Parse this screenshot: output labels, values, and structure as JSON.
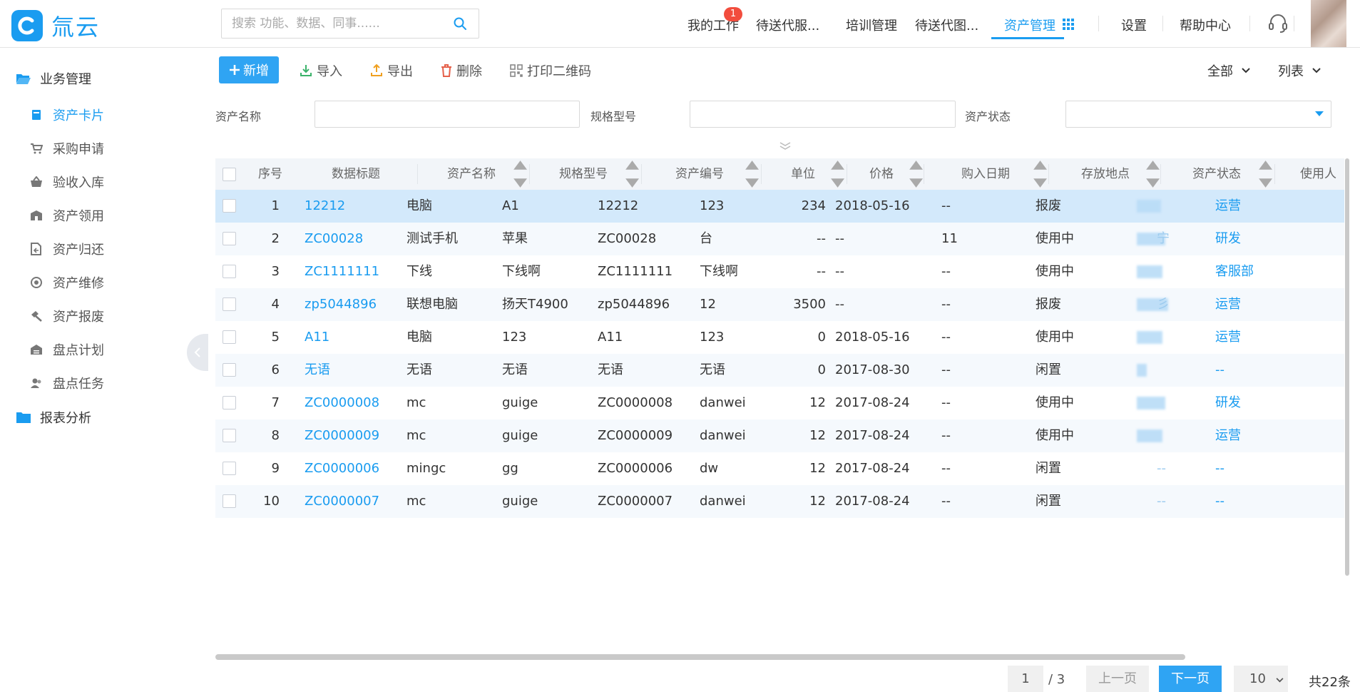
{
  "app": {
    "logo_text": "氚云"
  },
  "search": {
    "placeholder": "搜索 功能、数据、同事......"
  },
  "topnav": {
    "items": [
      "我的工作",
      "待送代服...",
      "培训管理",
      "待送代图...",
      "资产管理",
      "设置",
      "帮助中心"
    ],
    "badge": "1",
    "active": "资产管理"
  },
  "sidebar": {
    "group1": "业务管理",
    "items": [
      "资产卡片",
      "采购申请",
      "验收入库",
      "资产领用",
      "资产归还",
      "资产维修",
      "资产报废",
      "盘点计划",
      "盘点任务"
    ],
    "group2": "报表分析"
  },
  "toolbar": {
    "add": "新增",
    "import": "导入",
    "export": "导出",
    "delete": "删除",
    "print_qr": "打印二维码",
    "filter_all": "全部",
    "view_list": "列表"
  },
  "filters": {
    "asset_name": "资产名称",
    "spec_model": "规格型号",
    "asset_status": "资产状态"
  },
  "table": {
    "headers": [
      "序号",
      "数据标题",
      "资产名称",
      "规格型号",
      "资产编号",
      "单位",
      "价格",
      "购入日期",
      "存放地点",
      "资产状态",
      "使用人"
    ],
    "rows": [
      {
        "no": "1",
        "title": "12212",
        "name": "电脑",
        "spec": "A1",
        "code": "12212",
        "unit": "123",
        "price": "234",
        "date": "2018-05-16",
        "location": "--",
        "status": "报废",
        "user": "",
        "dept": "运营"
      },
      {
        "no": "2",
        "title": "ZC00028",
        "name": "测试手机",
        "spec": "苹果",
        "code": "ZC00028",
        "unit": "台",
        "price": "--",
        "date": "--",
        "location": "11",
        "status": "使用中",
        "user": "宁",
        "dept": "研发"
      },
      {
        "no": "3",
        "title": "ZC1111111",
        "name": "下线",
        "spec": "下线啊",
        "code": "ZC1111111",
        "unit": "下线啊",
        "price": "--",
        "date": "--",
        "location": "--",
        "status": "使用中",
        "user": "",
        "dept": "客服部"
      },
      {
        "no": "4",
        "title": "zp5044896",
        "name": "联想电脑",
        "spec": "扬天T4900",
        "code": "zp5044896",
        "unit": "12",
        "price": "3500",
        "date": "--",
        "location": "--",
        "status": "报废",
        "user": "彡",
        "dept": "运营"
      },
      {
        "no": "5",
        "title": "A11",
        "name": "电脑",
        "spec": "123",
        "code": "A11",
        "unit": "123",
        "price": "0",
        "date": "2018-05-16",
        "location": "--",
        "status": "使用中",
        "user": "",
        "dept": "运营"
      },
      {
        "no": "6",
        "title": "无语",
        "name": "无语",
        "spec": "无语",
        "code": "无语",
        "unit": "无语",
        "price": "0",
        "date": "2017-08-30",
        "location": "--",
        "status": "闲置",
        "user": "",
        "dept": "--"
      },
      {
        "no": "7",
        "title": "ZC0000008",
        "name": "mc",
        "spec": "guige",
        "code": "ZC0000008",
        "unit": "danwei",
        "price": "12",
        "date": "2017-08-24",
        "location": "--",
        "status": "使用中",
        "user": "",
        "dept": "研发"
      },
      {
        "no": "8",
        "title": "ZC0000009",
        "name": "mc",
        "spec": "guige",
        "code": "ZC0000009",
        "unit": "danwei",
        "price": "12",
        "date": "2017-08-24",
        "location": "--",
        "status": "使用中",
        "user": "",
        "dept": "运营"
      },
      {
        "no": "9",
        "title": "ZC0000006",
        "name": "mingc",
        "spec": "gg",
        "code": "ZC0000006",
        "unit": "dw",
        "price": "12",
        "date": "2017-08-24",
        "location": "--",
        "status": "闲置",
        "user": "--",
        "dept": "--"
      },
      {
        "no": "10",
        "title": "ZC0000007",
        "name": "mc",
        "spec": "guige",
        "code": "ZC0000007",
        "unit": "danwei",
        "price": "12",
        "date": "2017-08-24",
        "location": "--",
        "status": "闲置",
        "user": "--",
        "dept": "--"
      }
    ]
  },
  "pagination": {
    "current": "1",
    "total_pages": "/ 3",
    "prev": "上一页",
    "next": "下一页",
    "page_size": "10",
    "count": "共22条"
  },
  "colors": {
    "accent": "#1a9cf0",
    "primary_button": "#2fa4f3",
    "badge": "#f24d3d",
    "selected_row": "#d3e9fb"
  }
}
